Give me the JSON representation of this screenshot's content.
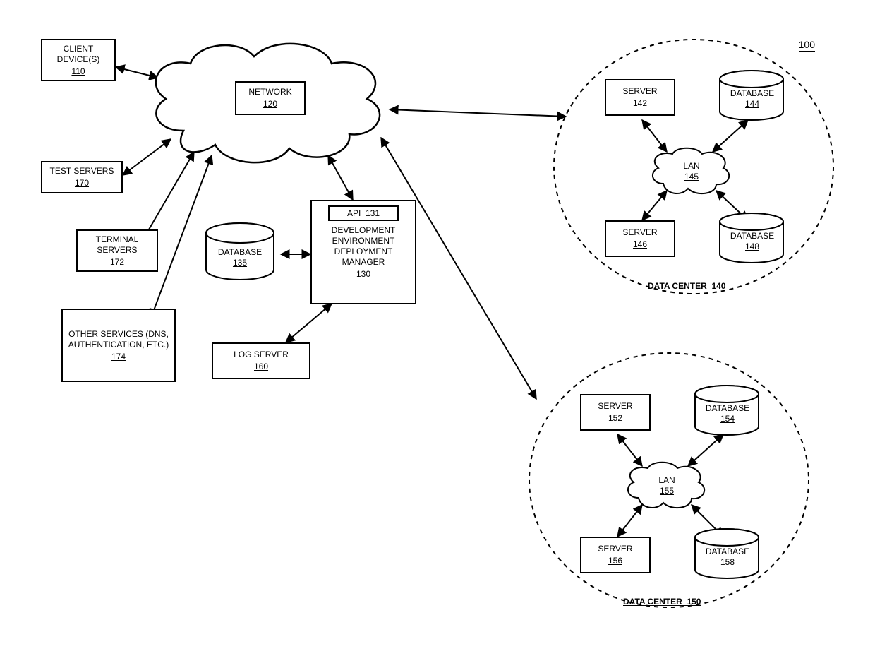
{
  "figure_number": "100",
  "client_device": {
    "label": "CLIENT DEVICE(S)",
    "num": "110"
  },
  "network": {
    "label": "NETWORK",
    "num": "120"
  },
  "dedm": {
    "api_label": "API",
    "api_num": "131",
    "label": "DEVELOPMENT ENVIRONMENT DEPLOYMENT MANAGER",
    "num": "130"
  },
  "database_main": {
    "label": "DATABASE",
    "num": "135"
  },
  "log_server": {
    "label": "LOG SERVER",
    "num": "160"
  },
  "test_servers": {
    "label": "TEST SERVERS",
    "num": "170"
  },
  "terminal_servers": {
    "label": "TERMINAL SERVERS",
    "num": "172"
  },
  "other_services": {
    "label": "OTHER SERVICES (DNS, AUTHENTICATION, ETC.)",
    "num": "174"
  },
  "data_center_1": {
    "label": "DATA CENTER",
    "num": "140",
    "server_a": {
      "label": "SERVER",
      "num": "142"
    },
    "db_a": {
      "label": "DATABASE",
      "num": "144"
    },
    "lan": {
      "label": "LAN",
      "num": "145"
    },
    "server_b": {
      "label": "SERVER",
      "num": "146"
    },
    "db_b": {
      "label": "DATABASE",
      "num": "148"
    }
  },
  "data_center_2": {
    "label": "DATA CENTER",
    "num": "150",
    "server_a": {
      "label": "SERVER",
      "num": "152"
    },
    "db_a": {
      "label": "DATABASE",
      "num": "154"
    },
    "lan": {
      "label": "LAN",
      "num": "155"
    },
    "server_b": {
      "label": "SERVER",
      "num": "156"
    },
    "db_b": {
      "label": "DATABASE",
      "num": "158"
    }
  }
}
